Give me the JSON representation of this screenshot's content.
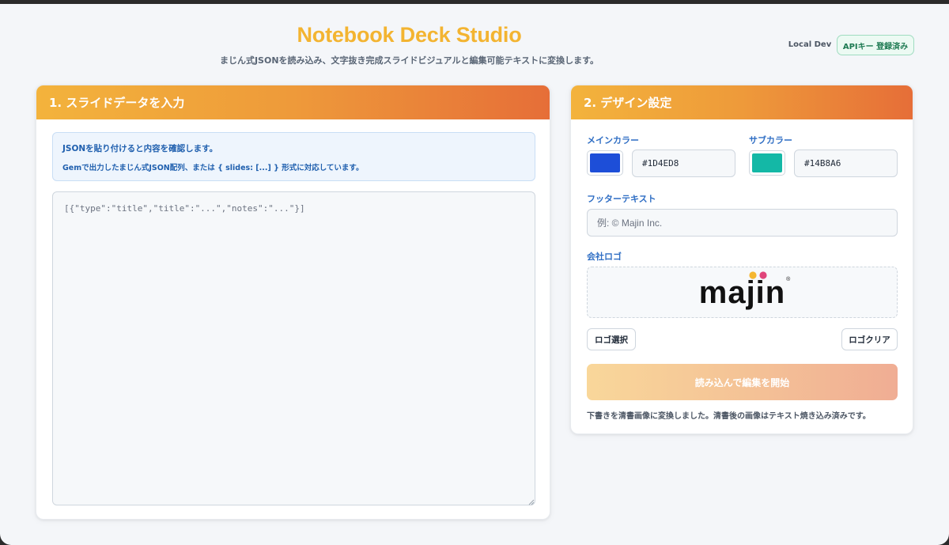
{
  "header": {
    "title": "Notebook Deck Studio",
    "subtitle": "まじん式JSONを読み込み、文字抜き完成スライドビジュアルと編集可能テキストに変換します。",
    "env_label": "Local Dev",
    "api_status": "APIキー 登録済み"
  },
  "input_panel": {
    "title": "1. スライドデータを入力",
    "info_line1": "JSONを貼り付けると内容を確認します。",
    "info_line2": "Gemで出力したまじん式JSON配列、または { slides: [...] } 形式に対応しています。",
    "json_placeholder": "[{\"type\":\"title\",\"title\":\"...\",\"notes\":\"...\"}]",
    "json_value": ""
  },
  "design_panel": {
    "title": "2. デザイン設定",
    "main_color_label": "メインカラー",
    "main_color": "#1D4ED8",
    "sub_color_label": "サブカラー",
    "sub_color": "#14B8A6",
    "footer_label": "フッターテキスト",
    "footer_placeholder": "例: © Majin Inc.",
    "footer_value": "",
    "logo_label": "会社ロゴ",
    "logo_text": "majin",
    "logo_dot_colors": [
      "#F5B731",
      "#E0457B"
    ],
    "select_logo_button": "ロゴ選択",
    "clear_logo_button": "ロゴクリア",
    "start_button": "読み込んで編集を開始",
    "status_message": "下書きを清書画像に変換しました。清書後の画像はテキスト焼き込み済みです。"
  }
}
